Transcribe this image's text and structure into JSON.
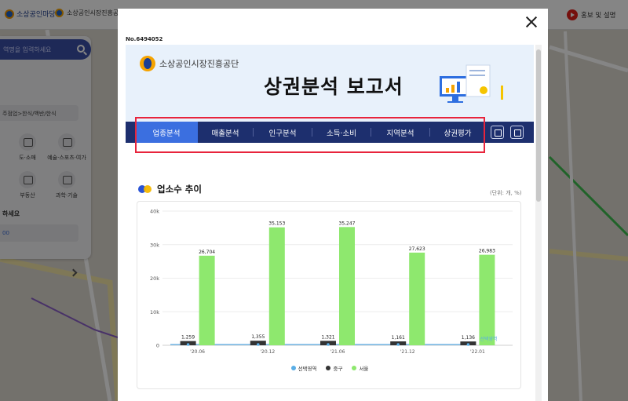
{
  "app": {
    "logo_left": "소상공인마당",
    "logo_org": "소상공인시장진흥공단",
    "help_label": "홍보 및 설명"
  },
  "sidepanel": {
    "search_placeholder": "역명을 입력하세요",
    "breadcrumb": "주점업>한식/백반/한식",
    "categories": [
      "도·소매",
      "예술·스포츠·여가",
      "부동산",
      "과학·기술"
    ],
    "select_label": "하세요",
    "select_value": "00"
  },
  "modal": {
    "doc_no": "No.6494052",
    "header": {
      "org_name": "소상공인시장진흥공단",
      "title": "상권분석 보고서"
    },
    "tabs": [
      {
        "label": "업종분석",
        "active": true
      },
      {
        "label": "매출분석",
        "active": false
      },
      {
        "label": "인구분석",
        "active": false
      },
      {
        "label": "소득·소비",
        "active": false
      },
      {
        "label": "지역분석",
        "active": false
      },
      {
        "label": "상권평가",
        "active": false
      }
    ],
    "tab_icons": [
      "print-icon",
      "save-icon"
    ],
    "section": {
      "title": "업소수 추이",
      "unit": "(단위: 개, %)"
    }
  },
  "colors": {
    "accent": "#3b6fe0",
    "tab_bar": "#1d2f6e",
    "highlight": "#e8243c",
    "series_selected": "#5aaee6",
    "series_district": "#333333",
    "series_seoul": "#8ee86e"
  },
  "chart_data": {
    "type": "bar",
    "title": "업소수 추이",
    "categories": [
      "'20.06",
      "'20.12",
      "'21.06",
      "'21.12",
      "'22.01"
    ],
    "ylim": [
      0,
      40000
    ],
    "yticks": [
      "0",
      "10k",
      "20k",
      "30k",
      "40k"
    ],
    "grid": true,
    "legend_position": "bottom",
    "series": [
      {
        "name": "선택영역",
        "type": "line",
        "values": [
          null,
          null,
          null,
          null,
          null
        ],
        "end_label": "선택영역"
      },
      {
        "name": "중구",
        "values": [
          1259,
          1355,
          1321,
          1161,
          1136
        ],
        "labels": [
          "1,259",
          "1,355",
          "1,321",
          "1,161",
          "1,136"
        ]
      },
      {
        "name": "서울",
        "values": [
          26704,
          35153,
          35247,
          27623,
          26983
        ],
        "labels": [
          "26,704",
          "35,153",
          "35,247",
          "27,623",
          "26,983"
        ]
      }
    ]
  }
}
